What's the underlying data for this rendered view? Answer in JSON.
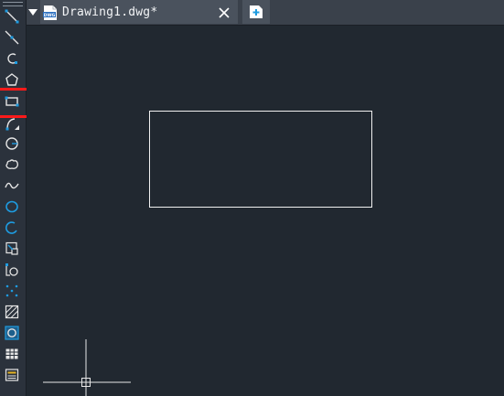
{
  "tab": {
    "title": "Drawing1.dwg*",
    "file_icon_label": "DWG",
    "menu_icon": "triangle-down-icon",
    "close_icon": "close-icon",
    "new_tab_icon": "new-tab-icon"
  },
  "toolbar": {
    "tools": [
      {
        "name": "line-icon"
      },
      {
        "name": "construction-line-icon"
      },
      {
        "name": "polyline-icon"
      },
      {
        "name": "polygon-icon"
      },
      {
        "name": "rectangle-icon"
      },
      {
        "name": "arc-icon"
      },
      {
        "name": "circle-center-icon"
      },
      {
        "name": "revision-cloud-icon"
      },
      {
        "name": "spline-icon"
      },
      {
        "name": "ellipse-icon"
      },
      {
        "name": "ellipse-arc-icon"
      },
      {
        "name": "insert-block-icon"
      },
      {
        "name": "create-block-icon"
      },
      {
        "name": "point-icon"
      },
      {
        "name": "hatch-icon"
      },
      {
        "name": "region-icon"
      },
      {
        "name": "table-icon"
      },
      {
        "name": "multiline-text-icon"
      }
    ],
    "highlighted_tool": "rectangle-icon"
  },
  "colors": {
    "canvas_bg": "#212830",
    "toolbar_bg": "#2b323c",
    "accent_blue": "#1e9be0",
    "highlight_red": "#ff1a1a",
    "geometry": "#f0f0f0"
  }
}
